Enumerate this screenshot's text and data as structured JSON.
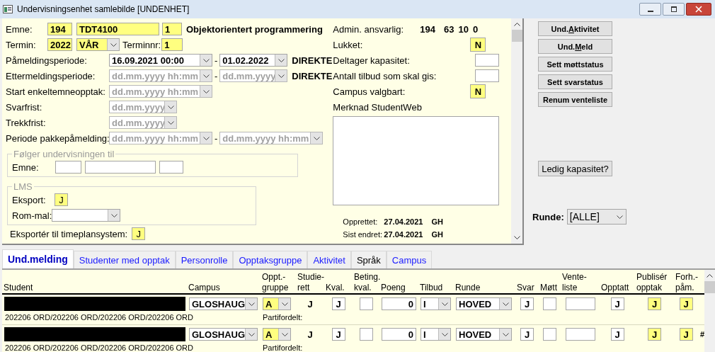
{
  "window": {
    "title": "Undervisningsenhet samlebilde [UNDENHET]"
  },
  "form": {
    "emne": {
      "label": "Emne:",
      "institution": "194",
      "code": "TDT4100",
      "version": "1",
      "name": "Objektorientert programmering"
    },
    "termin": {
      "label": "Termin:",
      "year": "2022",
      "season": "VÅR",
      "terminnr_label": "Terminnr:",
      "terminnr": "1"
    },
    "periods": [
      {
        "label": "Påmeldingsperiode:",
        "from": {
          "kind": "datetime",
          "value": "16.09.2021 00:00"
        },
        "separator": "-",
        "to": {
          "kind": "date",
          "value": "01.02.2022"
        },
        "suffix": "DIREKTE"
      },
      {
        "label": "Ettermeldingsperiode:",
        "from": {
          "kind": "datetime",
          "placeholder": "dd.mm.yyyy hh:mm"
        },
        "separator": "-",
        "to": {
          "kind": "date",
          "placeholder": "dd.mm.yyyy"
        },
        "suffix": "DIREKTE"
      },
      {
        "label": "Start enkeltemneopptak:",
        "from": {
          "kind": "datetime",
          "placeholder": "dd.mm.yyyy hh:mm"
        }
      },
      {
        "label": "Svarfrist:",
        "from": {
          "kind": "date",
          "placeholder": "dd.mm.yyyy"
        }
      },
      {
        "label": "Trekkfrist:",
        "from": {
          "kind": "date",
          "placeholder": "dd.mm.yyyy"
        }
      },
      {
        "label": "Periode pakkepåmelding:",
        "from": {
          "kind": "datetime",
          "placeholder": "dd.mm.yyyy hh:mm"
        },
        "separator": "-",
        "to": {
          "kind": "datetime",
          "placeholder": "dd.mm.yyyy hh:mm"
        }
      }
    ],
    "following": {
      "legend": "Følger undervisningen til",
      "label": "Emne:"
    },
    "lms": {
      "legend": "LMS",
      "eksport_label": "Eksport:",
      "eksport": "J",
      "rom_mal_label": "Rom-mal:"
    },
    "timeplan": {
      "label": "Eksportér til timeplansystem:",
      "value": "J"
    }
  },
  "details": {
    "admin": {
      "label": "Admin. ansvarlig:",
      "values": [
        "194",
        "63",
        "10",
        "0"
      ]
    },
    "lukket": {
      "label": "Lukket:",
      "value": "N"
    },
    "kapasitet_label": "Deltager kapasitet:",
    "tilbud_label": "Antall tilbud som skal gis:",
    "campus": {
      "label": "Campus valgbart:",
      "value": "N"
    },
    "merknad_label": "Merknad StudentWeb",
    "audit": [
      {
        "label": "Opprettet:",
        "date": "27.04.2021",
        "user": "GH"
      },
      {
        "label": "Sist endret:",
        "date": "27.04.2021",
        "user": "GH"
      }
    ]
  },
  "actions": {
    "buttons": [
      {
        "before": "Und.",
        "key": "A",
        "after": "ktivitet"
      },
      {
        "before": "Und.",
        "key": "M",
        "after": "eld"
      },
      {
        "before": "Sett møttstatus"
      },
      {
        "before": "Sett svarstatus"
      },
      {
        "before": "Renum venteliste"
      }
    ],
    "capacity_button": "Ledig kapasitet?",
    "runde": {
      "label": "Runde:",
      "value": "[ALLE]"
    }
  },
  "tabs": [
    {
      "label": "Und.melding",
      "selected": true,
      "kind": "link"
    },
    {
      "label": "Studenter med opptak",
      "selected": false,
      "kind": "link"
    },
    {
      "label": "Personrolle",
      "selected": false,
      "kind": "link"
    },
    {
      "label": "Opptaksgruppe",
      "selected": false,
      "kind": "link"
    },
    {
      "label": "Aktivitet",
      "selected": false,
      "kind": "link"
    },
    {
      "label": "Språk",
      "selected": false,
      "kind": "plain"
    },
    {
      "label": "Campus",
      "selected": false,
      "kind": "link"
    }
  ],
  "table": {
    "columns": [
      {
        "label": "Student"
      },
      {
        "label": "Campus"
      },
      {
        "label": "Oppt.-\ngruppe"
      },
      {
        "label": "Studie-\nrett"
      },
      {
        "label": "Kval."
      },
      {
        "label": "Beting.\nkval."
      },
      {
        "label": "Poeng"
      },
      {
        "label": "Tilbud"
      },
      {
        "label": "Runde"
      },
      {
        "label": "Svar"
      },
      {
        "label": "Møtt"
      },
      {
        "label": "Vente-\nliste"
      },
      {
        "label": "Opptatt"
      },
      {
        "label": "Publisér\nopptak"
      },
      {
        "label": "Forh.-\npåm."
      }
    ],
    "rows": [
      {
        "redacted": true,
        "programs": "202206 ORD/202206 ORD/202206 ORD/202206 ORD",
        "campus": "GLOSHAUG",
        "gruppe": "A",
        "note": "Partifordelt:",
        "studierett": "J",
        "kval": "J",
        "poeng": "0",
        "tilbud": "I",
        "runde": "HOVED",
        "svar": "J",
        "opptatt": "J",
        "publiser": "J",
        "forh": "J"
      },
      {
        "redacted": true,
        "programs": "202206 ORD/202206 ORD/202206 ORD/202206 ORD",
        "campus": "GLOSHAUG",
        "gruppe": "A",
        "note": "Partifordelt:",
        "studierett": "J",
        "kval": "J",
        "poeng": "0",
        "tilbud": "I",
        "runde": "HOVED",
        "svar": "J",
        "opptatt": "J",
        "publiser": "J",
        "forh": "J",
        "marker": "#"
      }
    ]
  }
}
